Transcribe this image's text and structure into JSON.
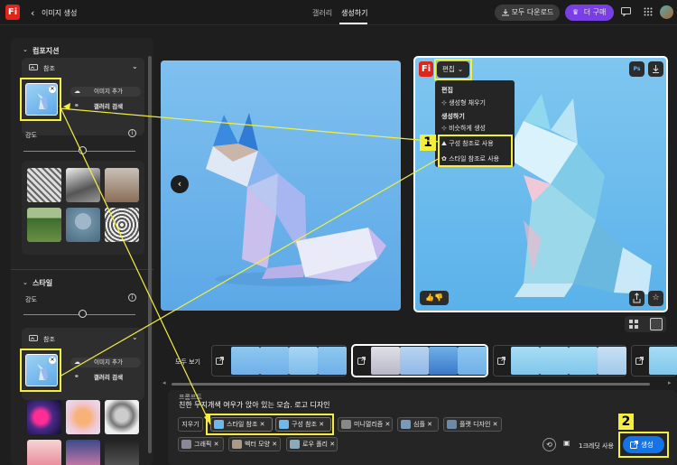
{
  "header": {
    "back_symbol": "‹",
    "title": "이미지 생성",
    "tabs": [
      "갤러리",
      "생성하기"
    ],
    "download_all": "모두 다운로드",
    "buy": "더 구매"
  },
  "sidebar": {
    "composition": {
      "heading": "컴포지션",
      "reference_label": "참조",
      "add_image": "이미지 추가",
      "gallery_search": "갤러리 검색",
      "strength_label": "강도"
    },
    "style": {
      "heading": "스타일",
      "strength_label": "강도",
      "reference_label": "참조",
      "add_image": "이미지 추가",
      "gallery_search": "갤러리 검색"
    }
  },
  "image_menu": {
    "edit_button": "편집",
    "section_edit": "편집",
    "item_generative_fill": "생성형 채우기",
    "section_generate": "생성하기",
    "item_similar": "비슷하게 생성",
    "item_use_composition": "구성 참조로 사용",
    "item_use_style": "스타일 참조로 사용",
    "ps_badge": "Ps"
  },
  "filmstrip": {
    "view_all": "모두 보기"
  },
  "prompt": {
    "label": "프롬프트",
    "text": "친한 무지개색 여우가 앉아 있는 모습. 로고 디자인"
  },
  "chips": {
    "clear": "지우기",
    "style_ref": "스타일 참조",
    "composition_ref": "구성 참조",
    "minimalism": "미니멀리즘",
    "simple": "심플",
    "flat_design": "플랫 디자인",
    "graphic": "그래픽",
    "vector_look": "벡터 모양",
    "low_poly": "로우 폴리"
  },
  "footer": {
    "credits": "1크레딧 사용",
    "generate": "생성"
  },
  "annotations": {
    "step1": "1",
    "step2": "2"
  },
  "colors": {
    "accent": "#1473e6",
    "brand": "#e1251b",
    "highlight": "#f5ef3b",
    "purple": "#7a3ee6"
  }
}
